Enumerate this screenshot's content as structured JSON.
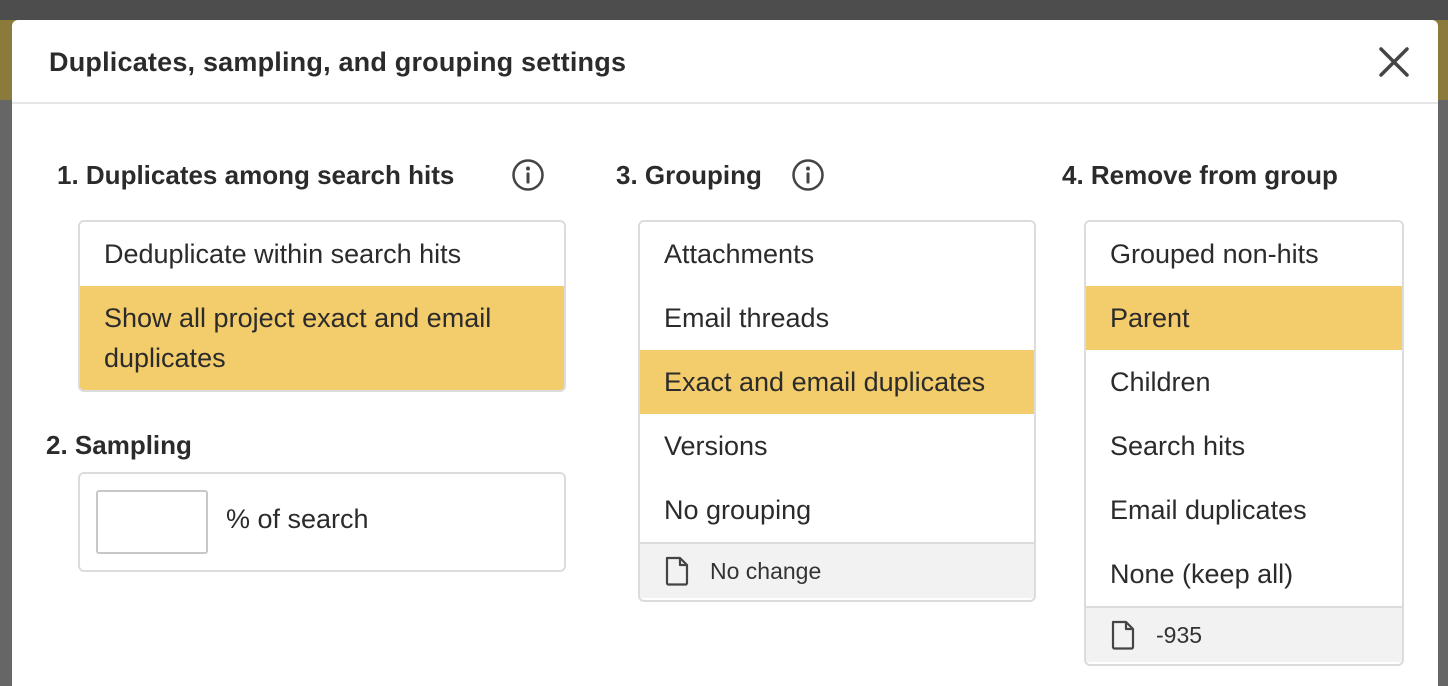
{
  "dialog": {
    "title": "Duplicates, sampling, and grouping settings",
    "close_icon": "close-icon"
  },
  "duplicates": {
    "title": "1. Duplicates among search hits",
    "info_icon": "info-icon",
    "options": [
      {
        "label": "Deduplicate within search hits",
        "selected": false
      },
      {
        "label": "Show all project exact and email duplicates",
        "selected": true
      }
    ]
  },
  "sampling": {
    "title": "2. Sampling",
    "input_value": "",
    "unit_label": "% of search"
  },
  "grouping": {
    "title": "3. Grouping",
    "info_icon": "info-icon",
    "options": [
      {
        "label": "Attachments",
        "selected": false
      },
      {
        "label": "Email threads",
        "selected": false
      },
      {
        "label": "Exact and email duplicates",
        "selected": true
      },
      {
        "label": "Versions",
        "selected": false
      },
      {
        "label": "No grouping",
        "selected": false
      }
    ],
    "footer_icon": "document-icon",
    "footer_text": "No change"
  },
  "remove": {
    "title": "4. Remove from group",
    "options": [
      {
        "label": "Grouped non-hits",
        "selected": false
      },
      {
        "label": "Parent",
        "selected": true
      },
      {
        "label": "Children",
        "selected": false
      },
      {
        "label": "Search hits",
        "selected": false
      },
      {
        "label": "Email duplicates",
        "selected": false
      },
      {
        "label": "None (keep all)",
        "selected": false
      }
    ],
    "footer_icon": "document-icon",
    "footer_text": "-935"
  },
  "colors": {
    "selected": "#f3cc6b",
    "border": "#dcdcdc",
    "footer_bg": "#f2f2f2"
  }
}
